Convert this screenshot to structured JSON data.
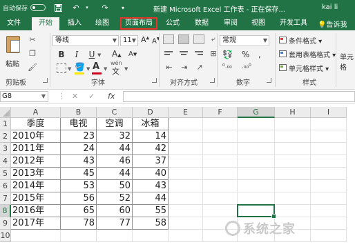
{
  "titlebar": {
    "autosave_label": "自动保存",
    "autosave_state": "●关",
    "title": "新建 Microsoft Excel 工作表 - 正在保存...",
    "user": "kai li"
  },
  "tabs": [
    "文件",
    "开始",
    "插入",
    "绘图",
    "页面布局",
    "公式",
    "数据",
    "审阅",
    "视图",
    "开发工具"
  ],
  "active_tab": "开始",
  "highlighted_tab": "页面布局",
  "tell_me": "告诉我",
  "ribbon": {
    "clipboard": {
      "paste": "粘贴",
      "label": "剪贴板"
    },
    "font": {
      "name": "等线",
      "size": "11",
      "label": "字体",
      "wen": "wén",
      "accent_fill": "#f4e400",
      "accent_font": "#d0021b"
    },
    "alignment": {
      "label": "对齐方式"
    },
    "number": {
      "format": "常规",
      "label": "数字"
    },
    "styles": {
      "cond": "条件格式",
      "table": "套用表格格式",
      "cell": "单元格样式",
      "label": "样式"
    },
    "cells": {
      "label": "单元格"
    }
  },
  "formula_bar": {
    "name_box": "G8",
    "fx": "fx",
    "value": ""
  },
  "grid": {
    "columns": [
      "A",
      "B",
      "C",
      "D",
      "E",
      "F",
      "G",
      "H",
      "I"
    ],
    "rows": [
      "1",
      "2",
      "3",
      "4",
      "5",
      "6",
      "7",
      "8",
      "9",
      "10"
    ],
    "selected_col": "G",
    "selected_row": "8",
    "header": [
      "季度",
      "电视",
      "空调",
      "冰箱"
    ],
    "data": [
      [
        "2010年",
        "23",
        "32",
        "14"
      ],
      [
        "2011年",
        "24",
        "44",
        "42"
      ],
      [
        "2012年",
        "43",
        "46",
        "37"
      ],
      [
        "2013年",
        "45",
        "44",
        "40"
      ],
      [
        "2014年",
        "53",
        "50",
        "43"
      ],
      [
        "2015年",
        "56",
        "52",
        "44"
      ],
      [
        "2016年",
        "65",
        "60",
        "55"
      ],
      [
        "2017年",
        "78",
        "77",
        "58"
      ]
    ]
  },
  "colors": {
    "excel_green": "#217346",
    "highlight_box": "#e8342a"
  }
}
